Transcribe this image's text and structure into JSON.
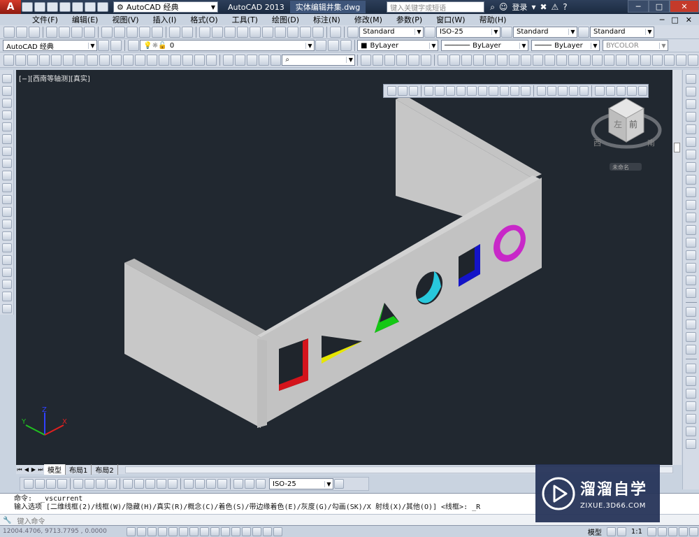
{
  "titlebar": {
    "logo_letter": "A",
    "workspace": "AutoCAD 经典",
    "app_title": "AutoCAD 2013",
    "file_name": "实体编辑井集.dwg",
    "search_placeholder": "键入关键字或短语",
    "login": "登录",
    "close_symbol": "✕",
    "min_symbol": "─",
    "max_symbol": "□"
  },
  "menu": [
    "文件(F)",
    "编辑(E)",
    "视图(V)",
    "插入(I)",
    "格式(O)",
    "工具(T)",
    "绘图(D)",
    "标注(N)",
    "修改(M)",
    "参数(P)",
    "窗口(W)",
    "帮助(H)"
  ],
  "toolbar1": {
    "text_style": "Standard",
    "dim_style": "ISO-25",
    "table_style": "Standard",
    "mleader_style": "Standard"
  },
  "toolbar2": {
    "workspace": "AutoCAD 经典",
    "layer": "0",
    "color": "ByLayer",
    "linetype": "ByLayer",
    "lineweight": "ByLayer",
    "plotstyle": "BYCOLOR"
  },
  "viewport": {
    "label": "[−][西南等轴测][真实]",
    "viewcube": {
      "top": "上",
      "front": "前",
      "left": "左",
      "west": "西",
      "south": "南",
      "compass_label": "未命名"
    },
    "ucs": {
      "x": "X",
      "y": "Y",
      "z": "Z"
    }
  },
  "layout_tabs": [
    "模型",
    "布局1",
    "布局2"
  ],
  "dim_toolbar": {
    "dim_style": "ISO-25"
  },
  "command": {
    "history_1": "命令:  _vscurrent",
    "history_2": "输入选项 [二维线框(2)/线框(W)/隐藏(H)/真实(R)/概念(C)/着色(S)/带边缘着色(E)/灰度(G)/勾画(SK)/X 射线(X)/其他(O)] <线框>: _R",
    "input_placeholder": "键入命令"
  },
  "statusbar": {
    "coords": "12004.4706,  9713.7795 , 0.0000",
    "model": "模型",
    "scale": "1:1"
  },
  "watermark": {
    "brand": "溜溜自学",
    "url": "ZIXUE.3D66.COM"
  },
  "colors": {
    "viewport_bg": "#212830",
    "wall": "#c8c8c8",
    "hole_red": "#d4141c",
    "hole_yellow": "#e6e600",
    "hole_green": "#14c814",
    "hole_cyan": "#28c8dc",
    "hole_blue": "#1414c8",
    "hole_magenta": "#c828c8"
  }
}
